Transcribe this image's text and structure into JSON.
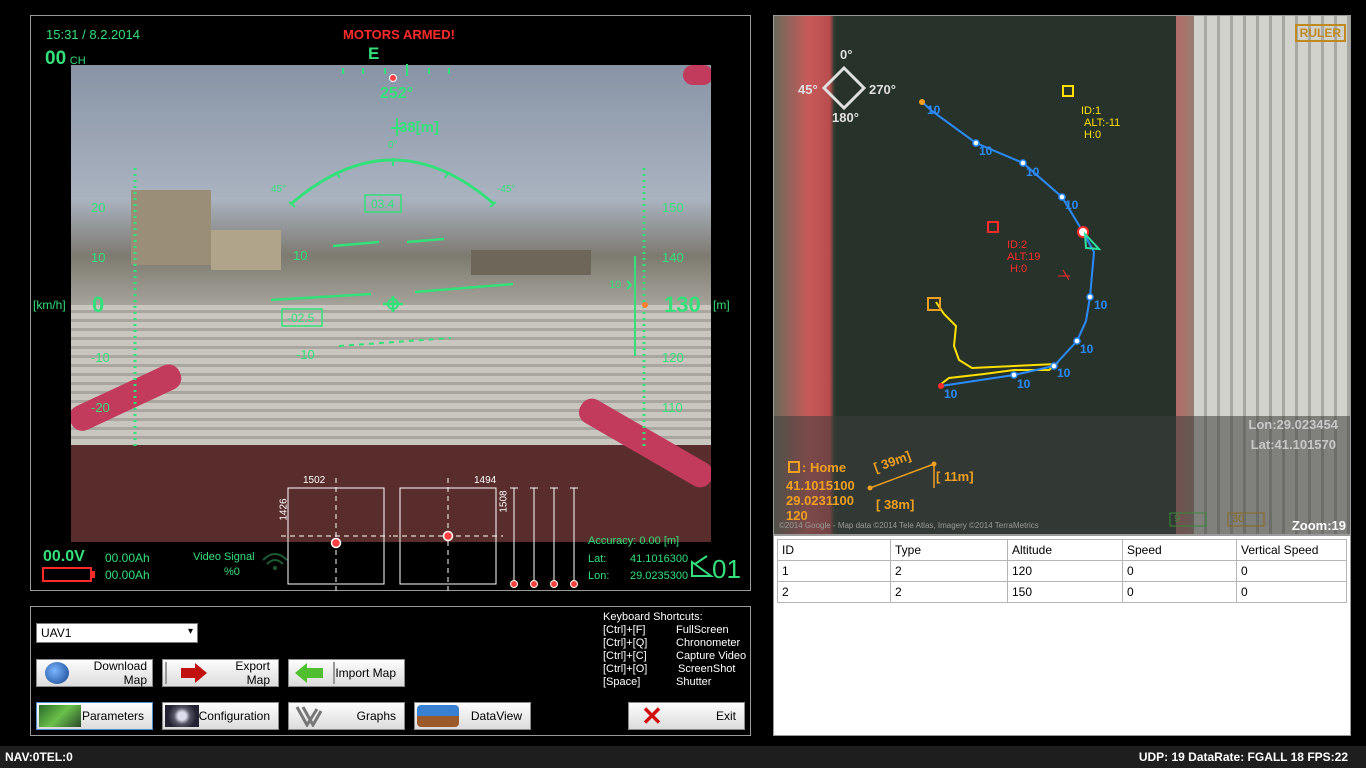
{
  "hud": {
    "datetime": "15:31 / 8.2.2014",
    "channel": "00",
    "channel_suffix": "CH",
    "motors_status": "MOTORS ARMED!",
    "compass_letter": "E",
    "heading": "252°",
    "altitude_box": "38[m]",
    "roll_zero": "0°",
    "roll_left": "45°",
    "roll_right": "-45°",
    "pitch_box_top": "03.4",
    "pitch_box_bottom": "-02.5",
    "pitch_10": "10",
    "pitch_m10": "-10",
    "speed_unit": "[km/h]",
    "speed_value": "0",
    "speed_ticks": [
      "20",
      "10",
      "-10",
      "-20"
    ],
    "alt_value": "130",
    "alt_unit": "[m]",
    "alt_ticks": [
      "150",
      "140",
      "120",
      "110"
    ],
    "alt_marker": "10",
    "voltage": "00.0V",
    "ah1": "00.00Ah",
    "ah2": "00.00Ah",
    "video_signal_label": "Video Signal",
    "video_signal_value": "%0",
    "rc_left_top": "1502",
    "rc_left_side": "1426",
    "rc_right_top": "1494",
    "rc_right_side": "1508",
    "accuracy": "Accuracy: 0.00 [m]",
    "lat_label": "Lat:",
    "lat_value": "41.1016300",
    "lon_label": "Lon:",
    "lon_value": "29.0235300",
    "sat_count": "01"
  },
  "map": {
    "ruler_label": "RULER",
    "compass": {
      "n": "0°",
      "w": "45°",
      "e": "270°",
      "s": "180°"
    },
    "waypoint_label": "10",
    "uav1": {
      "id": "ID:1",
      "alt": "ALT:-11",
      "h": "H:0"
    },
    "uav2": {
      "id": "ID:2",
      "alt": "ALT:19",
      "h": "H:0"
    },
    "lon_readout": "Lon:29.023454",
    "lat_readout": "Lat:41.101570",
    "home_label": ": Home",
    "home_lat": "41.1015100",
    "home_lon": "29.0231100",
    "home_alt": "120",
    "ruler_diag": "[ 39m]",
    "ruler_vert": "[ 11m]",
    "ruler_horiz": "[ 38m]",
    "credits": "©2014 Google - Map data ©2014 Tele Atlas, Imagery ©2014 TerraMetrics",
    "box_9": "9",
    "box_30": "30",
    "zoom": "Zoom:19"
  },
  "table": {
    "headers": [
      "ID",
      "Type",
      "Altitude",
      "Speed",
      "Vertical Speed"
    ],
    "rows": [
      [
        "1",
        "2",
        "120",
        "0",
        "0"
      ],
      [
        "2",
        "2",
        "150",
        "0",
        "0"
      ]
    ]
  },
  "controls": {
    "uav_select": "UAV1",
    "download_map": "Download Map",
    "export_map": "Export Map",
    "import_map": "Import Map",
    "parameters": "Parameters",
    "configuration": "Configuration",
    "graphs": "Graphs",
    "dataview": "DataView",
    "exit": "Exit",
    "shortcuts_title": "Keyboard Shortcuts:",
    "shortcuts": [
      [
        "[Ctrl]+[F]",
        "FullScreen"
      ],
      [
        "[Ctrl]+[Q]",
        "Chronometer"
      ],
      [
        "[Ctrl]+[C]",
        "Capture Video"
      ],
      [
        "[Ctrl]+[O]",
        "ScreenShot"
      ],
      [
        "[Space]",
        "Shutter"
      ]
    ]
  },
  "statusbar": {
    "left": "NAV:0TEL:0",
    "right": "UDP: 19 DataRate: FGALL 18 FPS:22"
  },
  "colors": {
    "hud_green": "#33e07a",
    "warning_red": "#ff2a2a",
    "map_orange": "#f0a020",
    "path_blue": "#2a8cff",
    "trail_yellow": "#ffe000"
  }
}
